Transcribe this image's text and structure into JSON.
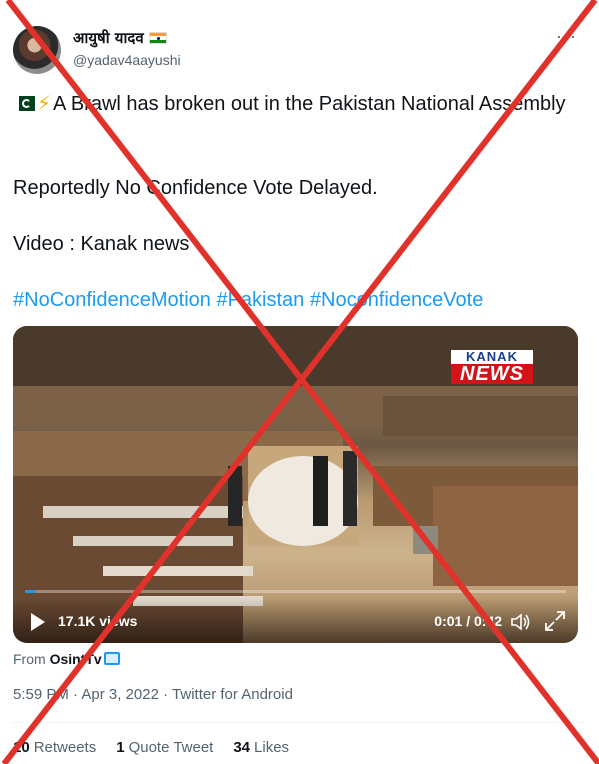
{
  "user": {
    "display_name": "आयुषी यादव",
    "handle": "@yadav4aayushi",
    "flag_icon": "india-flag-icon"
  },
  "tweet": {
    "line1": "A Brawl has broken out in the Pakistan National Assembly",
    "line2": "Reportedly No Confidence Vote Delayed.",
    "line3": "Video : Kanak news",
    "hashtags": [
      "#NoConfidenceMotion",
      "#Pakistan",
      "#NoconfidenceVote"
    ],
    "emoji_icons": [
      "pakistan-flag-icon",
      "lightning-icon"
    ]
  },
  "video": {
    "logo_top": "KANAK",
    "logo_bottom": "NEWS",
    "views": "17.1K views",
    "time": "0:01 / 0:42",
    "progress": 0.02
  },
  "source": {
    "prefix": "From",
    "name": "OsintTv"
  },
  "meta": {
    "time": "5:59 PM",
    "date": "Apr 3, 2022",
    "client": "Twitter for Android",
    "separator": "·"
  },
  "stats": {
    "retweets_count": "10",
    "retweets_label": "Retweets",
    "quotes_count": "1",
    "quotes_label": "Quote Tweet",
    "likes_count": "34",
    "likes_label": "Likes"
  },
  "colors": {
    "link": "#1d9bf0",
    "muted": "#536471",
    "cross": "#e0322b"
  }
}
